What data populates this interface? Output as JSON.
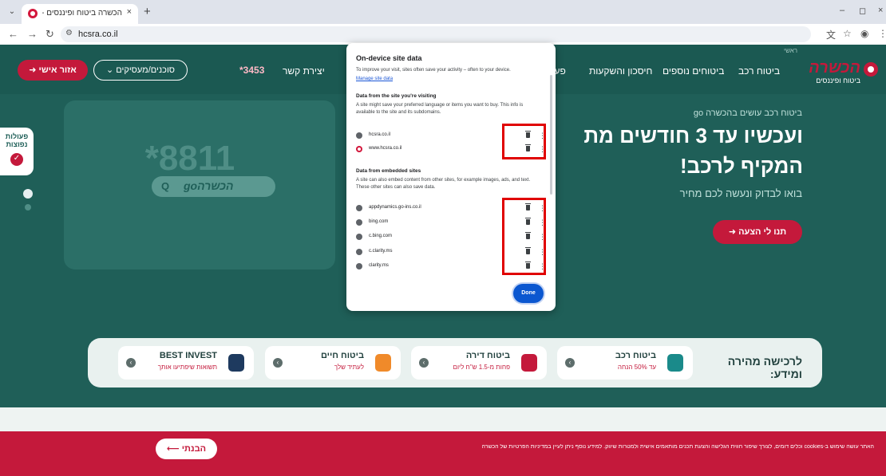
{
  "browser": {
    "tab_title": "הכשרה ביטוח ופיננסים - ביטוח",
    "tab_close": "×",
    "new_tab": "+",
    "url": "hcsra.co.il",
    "win_min": "–",
    "win_max": "◻",
    "win_close": "×"
  },
  "header": {
    "personal_button": "אזור אישי",
    "agents_button": "סוכנים/מעסיקים",
    "phone": "*3453",
    "nav": [
      "יצירת קשר",
      "פעול",
      "חיסכון והשקעות",
      "ביטוחים נוספים",
      "ביטוח רכב"
    ],
    "logo_name": "הכשרה",
    "logo_sub": "ביטוח ופיננסים",
    "breadcrumb": "ראשי"
  },
  "side_tab": {
    "label": "פעולות נפוצות"
  },
  "hero": {
    "number": "*8811",
    "search_brand": "הכשרהgo",
    "fine_print": "",
    "subtitle": "ביטוח רכב עושים בהכשרה go",
    "title_line1": "ועכשיו עד 3 חודשים מת",
    "title_line2": "המקיף לרכב!",
    "description": "בואו לבדוק ונעשה לכם מחיר",
    "cta": "תנו לי הצעה"
  },
  "quick": {
    "title": "לרכישה מהירה ומידע:",
    "cards": [
      {
        "name": "BEST INVEST",
        "desc": "תשואות שיפתיעו אותך",
        "color": "#1e3a5f"
      },
      {
        "name": "ביטוח חיים",
        "desc": "לעתיד שלך",
        "color": "#f08a2a"
      },
      {
        "name": "ביטוח דירה",
        "desc": "פחות מ-1.5 ש\"ח ליום",
        "color": "#c4193b"
      },
      {
        "name": "ביטוח רכב",
        "desc": "עד 50% הנחה",
        "color": "#1a8a8a"
      }
    ]
  },
  "cookie": {
    "got_it": "הבנתי",
    "text": "האתר עושה שימוש ב-cookies וכלים דומים, לצורך שיפור חווית הגלישה והצעת תכנים מותאמים אישית ולמטרות שיווק. למידע נוסף ניתן לעיין במדיניות הפרטיות של הכשרה"
  },
  "dialog": {
    "title": "On-device site data",
    "intro": "To improve your visit, sites often save your activity – often to your device.",
    "manage_link": "Manage site data",
    "visiting_title": "Data from the site you're visiting",
    "visiting_desc": "A site might save your preferred language or items you want to buy. This info is available to the site and its subdomains.",
    "visiting_sites": [
      "hcsra.co.il",
      "www.hcsra.co.il"
    ],
    "embedded_title": "Data from embedded sites",
    "embedded_desc": "A site can also embed content from other sites, for example images, ads, and text. These other sites can also save data.",
    "embedded_sites": [
      "appdynamics.go-ins.co.il",
      "bing.com",
      "c.bing.com",
      "c.clarity.ms",
      "clarity.ms"
    ],
    "done": "Done"
  },
  "colors": {
    "brand_red": "#c4193b",
    "teal": "#1f5f58",
    "highlight": "#e00000",
    "done_blue": "#0b57d0"
  }
}
